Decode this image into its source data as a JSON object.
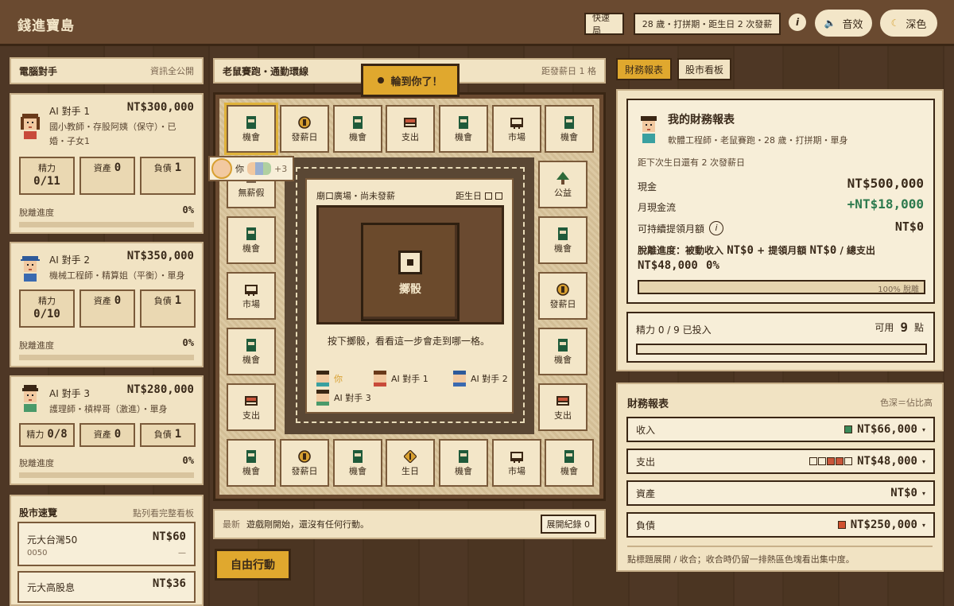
{
  "app": {
    "title": "錢進寶島"
  },
  "topbar": {
    "quick": "快速局",
    "status": "28 歲・打拼期・距生日 2 次發薪",
    "info": "i",
    "sound": "音效",
    "theme": "深色"
  },
  "left": {
    "header": {
      "title": "電腦對手",
      "sub": "資訊全公開"
    },
    "opponents": [
      {
        "name": "AI 對手 1",
        "cash": "NT$300,000",
        "desc": "國小教師・存股阿姨（保守）・已婚・子女1",
        "energy_label": "精力",
        "energy": "0/11",
        "assets_label": "資產",
        "assets": "0",
        "debt_label": "負債",
        "debt": "1",
        "progress_label": "脫離進度",
        "progress": "0%",
        "progress_value": 0
      },
      {
        "name": "AI 對手 2",
        "cash": "NT$350,000",
        "desc": "機械工程師・精算姐（平衡）・單身",
        "energy_label": "精力",
        "energy": "0/10",
        "assets_label": "資產",
        "assets": "0",
        "debt_label": "負債",
        "debt": "1",
        "progress_label": "脫離進度",
        "progress": "0%",
        "progress_value": 0
      },
      {
        "name": "AI 對手 3",
        "cash": "NT$280,000",
        "desc": "護理師・槓桿哥（激進）・單身",
        "energy_label": "精力",
        "energy": "0/8",
        "assets_label": "資產",
        "assets": "0",
        "debt_label": "負債",
        "debt": "1",
        "progress_label": "脫離進度",
        "progress": "0%",
        "progress_value": 0
      }
    ],
    "stocks": {
      "title": "股市速覽",
      "sub": "點列看完整看板",
      "items": [
        {
          "name": "元大台灣50",
          "code": "0050",
          "price": "NT$60",
          "change": "—"
        },
        {
          "name": "元大高股息",
          "code": "",
          "price": "NT$36",
          "change": ""
        }
      ]
    }
  },
  "board": {
    "header": {
      "title": "老鼠賽跑・通勤環線",
      "sub": "距發薪日 1 格"
    },
    "turn": "輪到你了！",
    "you_label": "你",
    "you_more": "+3",
    "top_row": [
      "機會",
      "發薪日",
      "機會",
      "支出",
      "機會",
      "市場",
      "機會"
    ],
    "bottom_row": [
      "機會",
      "發薪日",
      "機會",
      "生日",
      "機會",
      "市場",
      "機會"
    ],
    "left_col": [
      "無薪假",
      "機會",
      "市場",
      "機會",
      "支出"
    ],
    "right_col": [
      "公益",
      "機會",
      "發薪日",
      "機會",
      "支出"
    ],
    "center": {
      "location": "廟口廣場・尚未發薪",
      "birthday": "距生日",
      "roll": "擲骰",
      "hint": "按下擲骰，看看這一步會走到哪一格。",
      "players": [
        "你",
        "AI 對手 1",
        "AI 對手 2",
        "AI 對手 3"
      ]
    },
    "log": {
      "prefix": "最新",
      "text": "遊戲剛開始，還沒有任何行動。",
      "expand": "展開紀錄 0"
    },
    "free_action": "自由行動"
  },
  "right": {
    "tabs": [
      "財務報表",
      "股市看板"
    ],
    "me": {
      "title": "我的財務報表",
      "sub": "軟體工程師・老鼠賽跑・28 歲・打拼期・單身",
      "next_bday": "距下次生日還有 2 次發薪日",
      "cash_label": "現金",
      "cash": "NT$500,000",
      "flow_label": "月現金流",
      "flow": "+NT$18,000",
      "withdraw_label": "可持續提領月額",
      "withdraw": "NT$0",
      "escape_prefix": "脫離進度：被動收入",
      "passive": "NT$0",
      "plus": "+ 提領月額",
      "withdraw2": "NT$0",
      "slash": "/ 總支出",
      "total_exp": "NT$48,000",
      "escape_pct": "0%",
      "bar_label": "100% 脫離",
      "escape_value": 0
    },
    "energy": {
      "label": "精力 0 / 9 已投入",
      "avail_label": "可用",
      "avail": "9",
      "unit": "點",
      "used_value": 0
    },
    "fs": {
      "title": "財務報表",
      "sub": "色深＝佔比高",
      "rows": [
        {
          "label": "收入",
          "value": "NT$66,000"
        },
        {
          "label": "支出",
          "value": "NT$48,000"
        },
        {
          "label": "資產",
          "value": "NT$0"
        },
        {
          "label": "負債",
          "value": "NT$250,000"
        }
      ],
      "footer": "點標題展開 / 收合；收合時仍留一排熱區色塊看出集中度。"
    }
  },
  "colors": {
    "accent": "#e0a82e",
    "income": "#3a8a5a",
    "expense": "#c8553a",
    "debt": "#d0502e",
    "positive": "#2e7a4e"
  }
}
